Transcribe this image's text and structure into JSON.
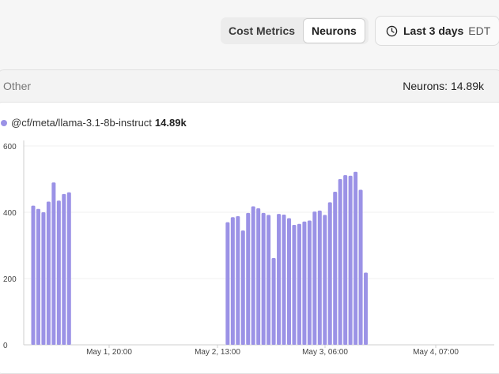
{
  "toolbar": {
    "metric_tabs": [
      {
        "label": "Cost Metrics",
        "active": false
      },
      {
        "label": "Neurons",
        "active": true
      }
    ],
    "time_range": {
      "label": "Last 3 days",
      "timezone": "EDT",
      "icon": "clock-icon"
    }
  },
  "panel": {
    "title": "Other",
    "total": "Neurons: 14.89k"
  },
  "legend": {
    "series_name": "@cf/meta/llama-3.1-8b-instruct",
    "series_value": "14.89k",
    "color": "#9b92e6"
  },
  "chart_data": {
    "type": "bar",
    "y_ticks": [
      "600",
      "400",
      "200",
      "0"
    ],
    "x_ticks": [
      "May 1, 20:00",
      "May 2, 13:00",
      "May 3, 06:00",
      "May 4, 07:00"
    ],
    "ylim": [
      0,
      600
    ],
    "grid": true,
    "series": [
      {
        "name": "@cf/meta/llama-3.1-8b-instruct",
        "color": "#9b92e6",
        "values": [
          420,
          410,
          400,
          432,
          490,
          435,
          455,
          460,
          null,
          null,
          null,
          null,
          null,
          null,
          null,
          null,
          null,
          null,
          null,
          null,
          null,
          null,
          null,
          null,
          null,
          null,
          null,
          null,
          null,
          null,
          null,
          null,
          null,
          null,
          null,
          null,
          null,
          null,
          370,
          385,
          388,
          345,
          398,
          418,
          412,
          398,
          392,
          262,
          395,
          393,
          382,
          362,
          365,
          372,
          375,
          402,
          405,
          392,
          430,
          462,
          500,
          512,
          510,
          522,
          468,
          218
        ]
      }
    ]
  }
}
